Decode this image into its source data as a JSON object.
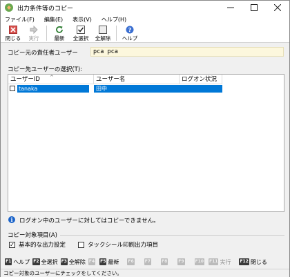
{
  "window": {
    "title": "出力条件等のコピー"
  },
  "menu": [
    "ファイル(F)",
    "編集(E)",
    "表示(V)",
    "ヘルプ(H)"
  ],
  "toolbar": {
    "close": "閉じる",
    "execute": "実行",
    "refresh": "最新",
    "select_all": "全選択",
    "deselect_all": "全解除",
    "help": "ヘルプ"
  },
  "source": {
    "label": "コピー元の責任者ユーザー",
    "value": "pca pca"
  },
  "dest": {
    "label": "コピー先ユーザーの選択(T):"
  },
  "list": {
    "columns": [
      "ユーザーID",
      "ユーザー名",
      "ログオン状況"
    ],
    "rows": [
      {
        "user_id": "tanaka",
        "user_name": "田中",
        "logon_status": "",
        "checked": false
      }
    ]
  },
  "info": {
    "text": "ログオン中のユーザーに対してはコピーできません。"
  },
  "copy_items": {
    "label": "コピー対象項目(A)",
    "options": [
      {
        "label": "基本的な出力設定",
        "checked": true
      },
      {
        "label": "タックシール印刷出力項目",
        "checked": false
      }
    ]
  },
  "fkeys": [
    {
      "key": "F1",
      "label": "ヘルプ",
      "enabled": true
    },
    {
      "key": "F2",
      "label": "全選択",
      "enabled": true
    },
    {
      "key": "F3",
      "label": "全解除",
      "enabled": true
    },
    {
      "key": "F4",
      "label": "",
      "enabled": false
    },
    {
      "key": "F5",
      "label": "最新",
      "enabled": true
    },
    {
      "key": "F6",
      "label": "",
      "enabled": false
    },
    {
      "key": "F7",
      "label": "",
      "enabled": false
    },
    {
      "key": "F8",
      "label": "",
      "enabled": false
    },
    {
      "key": "F9",
      "label": "",
      "enabled": false
    },
    {
      "key": "F10",
      "label": "",
      "enabled": false
    },
    {
      "key": "F11",
      "label": "実行",
      "enabled": false
    },
    {
      "key": "F12",
      "label": "閉じる",
      "enabled": true
    }
  ],
  "status": {
    "text": "コピー対象のユーザーにチェックをしてください。"
  }
}
